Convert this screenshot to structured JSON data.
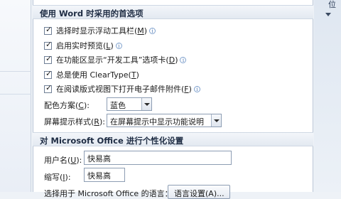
{
  "right_partial_text": "位",
  "section1": {
    "title": "使用 Word 时采用的首选项",
    "options": [
      {
        "label_pre": "选择时显示浮动工具栏(",
        "key": "M",
        "label_post": ")",
        "checked": true,
        "info": true
      },
      {
        "label_pre": "启用实时预览(",
        "key": "L",
        "label_post": ")",
        "checked": true,
        "info": true
      },
      {
        "label_pre": "在功能区显示“开发工具”选项卡(",
        "key": "D",
        "label_post": ")",
        "checked": true,
        "info": true
      },
      {
        "label_pre": "总是使用 ClearType(",
        "key": "T",
        "label_post": ")",
        "checked": true,
        "info": false
      },
      {
        "label_pre": "在阅读版式视图下打开电子邮件附件(",
        "key": "F",
        "label_post": ")",
        "checked": true,
        "info": true
      }
    ],
    "color_scheme": {
      "label_pre": "配色方案(",
      "key": "C",
      "label_post": "):",
      "value": "蓝色"
    },
    "tooltip_style": {
      "label_pre": "屏幕提示样式(",
      "key": "R",
      "label_post": "):",
      "value": "在屏幕提示中显示功能说明"
    }
  },
  "section2": {
    "title": "对 Microsoft Office 进行个性化设置",
    "username": {
      "label_pre": "用户名(",
      "key": "U",
      "label_post": "):",
      "value": "快易高"
    },
    "initials": {
      "label_pre": "缩写(",
      "key": "I",
      "label_post": "):",
      "value": "快易高"
    },
    "language_partial": "选择用于 Microsoft Office 的语言：",
    "language_button": "语言设置(A)..."
  }
}
